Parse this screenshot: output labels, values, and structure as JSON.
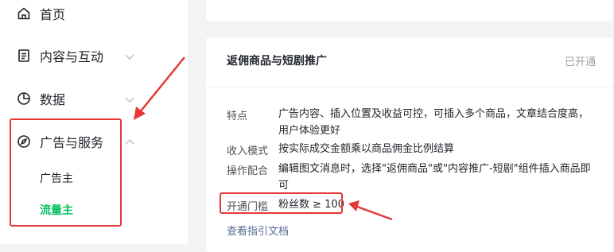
{
  "sidebar": {
    "items": [
      {
        "label": "首页",
        "icon": "home-icon"
      },
      {
        "label": "内容与互动",
        "icon": "document-icon"
      },
      {
        "label": "数据",
        "icon": "chart-pie-icon"
      },
      {
        "label": "广告与服务",
        "icon": "compass-icon"
      }
    ],
    "sub_items": [
      {
        "label": "广告主",
        "active": false
      },
      {
        "label": "流量主",
        "active": true
      }
    ]
  },
  "card": {
    "title": "返佣商品与短剧推广",
    "status": "已开通",
    "rows": [
      {
        "label": "特点",
        "value": "广告内容、插入位置及收益可控，可插入多个商品，文章结合度高，用户体验更好"
      },
      {
        "label": "收入模式",
        "value": "按实际成交金额乘以商品佣金比例结算"
      },
      {
        "label": "操作配合",
        "value": "编辑图文消息时，选择\"返佣商品\"或\"内容推广-短剧\"组件插入商品即可"
      },
      {
        "label": "开通门槛",
        "value": "粉丝数 ≥ 100"
      }
    ],
    "link": "查看指引文档"
  },
  "colors": {
    "accent_green": "#07c160",
    "annotation_red": "#e53935",
    "link_blue": "#576b95"
  }
}
